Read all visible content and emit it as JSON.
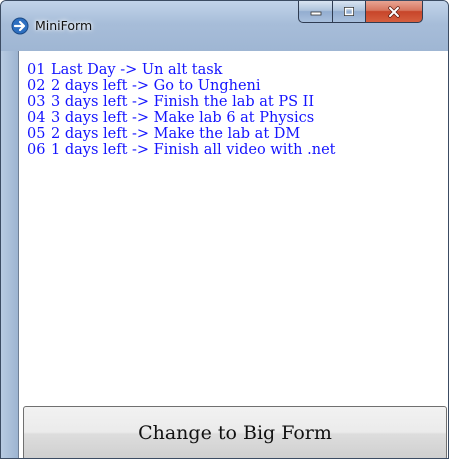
{
  "window": {
    "title": "MiniForm",
    "icon": "app-arrow-icon",
    "caption_buttons": {
      "minimize": "minimize-icon",
      "maximize": "maximize-icon",
      "close": "close-icon"
    }
  },
  "tasks": [
    {
      "num": "01",
      "text": "Last Day -> Un alt task"
    },
    {
      "num": "02",
      "text": "2 days left -> Go to Ungheni"
    },
    {
      "num": "03",
      "text": "3 days left -> Finish the lab at PS II"
    },
    {
      "num": "04",
      "text": "3 days left -> Make lab 6 at Physics"
    },
    {
      "num": "05",
      "text": "2 days left -> Make the lab at DM"
    },
    {
      "num": "06",
      "text": "1 days left -> Finish all video with .net"
    }
  ],
  "button": {
    "label": "Change to Big Form"
  },
  "colors": {
    "task_text": "#1414ff",
    "close_button": "#c7452a",
    "title_bar": "#a7bdd9"
  }
}
